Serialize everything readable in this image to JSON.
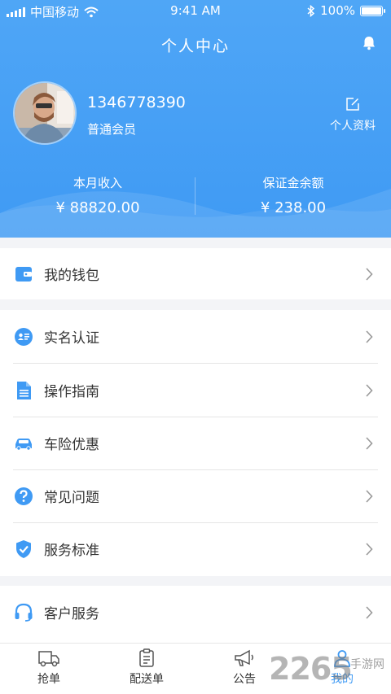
{
  "status_bar": {
    "carrier": "中国移动",
    "time": "9:41 AM",
    "battery": "100%"
  },
  "header": {
    "title": "个人中心"
  },
  "profile": {
    "phone": "1346778390",
    "level": "普通会员",
    "edit_label": "个人资料"
  },
  "stats": {
    "income_label": "本月收入",
    "income_value": "¥ 88820.00",
    "deposit_label": "保证金余额",
    "deposit_value": "¥ 238.00"
  },
  "menu": {
    "wallet": "我的钱包",
    "verify": "实名认证",
    "guide": "操作指南",
    "insurance": "车险优惠",
    "faq": "常见问题",
    "standard": "服务标准",
    "service": "客户服务"
  },
  "tabs": {
    "grab": "抢单",
    "delivery": "配送单",
    "notice": "公告",
    "mine": "我的"
  },
  "watermark": {
    "number": "2265",
    "site": "手游网"
  },
  "colors": {
    "accent": "#3f9af4",
    "header_top": "#4fa6f6"
  }
}
